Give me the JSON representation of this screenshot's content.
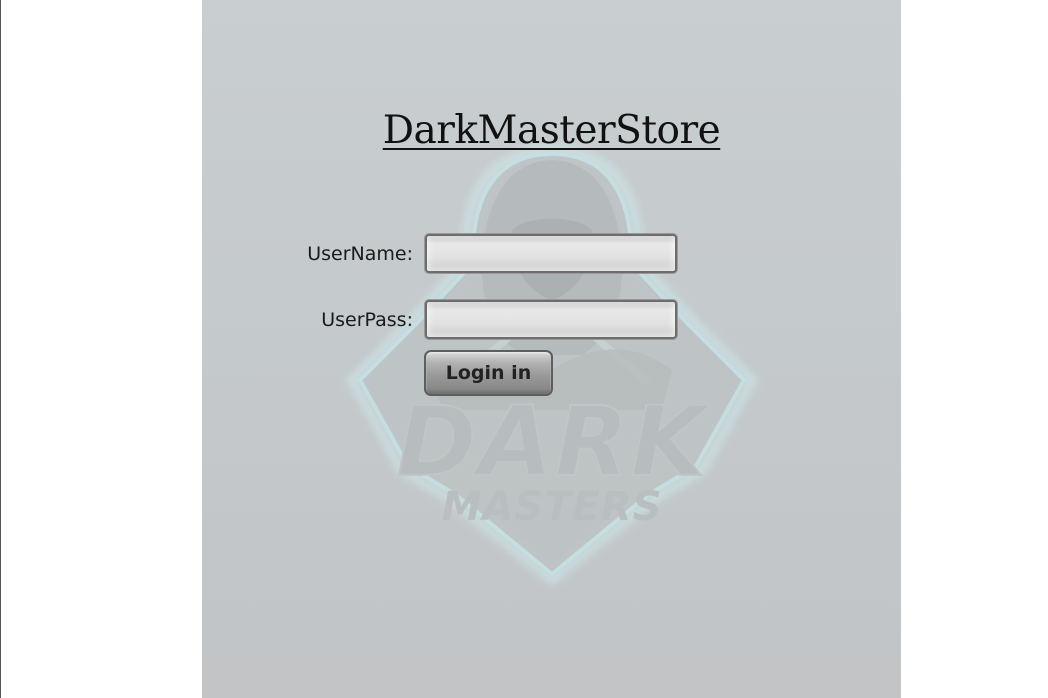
{
  "page": {
    "title": "DarkMasterStore"
  },
  "form": {
    "username_label": "UserName:",
    "username_value": "",
    "userpass_label": "UserPass:",
    "userpass_value": "",
    "login_button_label": "Login in"
  },
  "background_logo": {
    "icon": "dark-masters-logo",
    "text_line1": "DARK",
    "text_line2": "MASTERS"
  },
  "colors": {
    "panel_background": "#c7cbcd",
    "logo_accent": "#bfe6ea",
    "button": "#9a9a9a"
  }
}
